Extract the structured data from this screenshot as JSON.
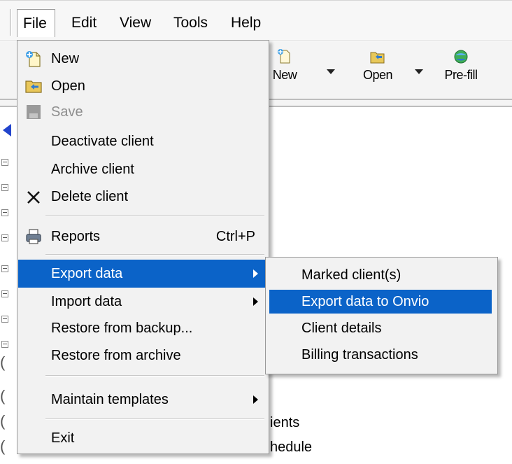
{
  "menubar": {
    "items": [
      "File",
      "Edit",
      "View",
      "Tools",
      "Help"
    ]
  },
  "toolbar": {
    "buttons": [
      {
        "label": "New",
        "icon": "new-document-icon",
        "has_dropdown": true
      },
      {
        "label": "Open",
        "icon": "open-folder-icon",
        "has_dropdown": true
      },
      {
        "label": "Pre-fill",
        "icon": "globe-icon",
        "has_dropdown": false
      }
    ]
  },
  "tree": {
    "partial_texts": [
      "ients",
      "hedule"
    ]
  },
  "file_menu": {
    "items": [
      {
        "label": "New",
        "icon": "new-document-icon",
        "enabled": true
      },
      {
        "label": "Open",
        "icon": "open-folder-icon",
        "enabled": true
      },
      {
        "label": "Save",
        "icon": "save-icon",
        "enabled": false
      },
      {
        "label": "Deactivate client",
        "enabled": true
      },
      {
        "label": "Archive client",
        "enabled": true
      },
      {
        "label": "Delete client",
        "icon": "delete-x-icon",
        "enabled": true
      },
      {
        "label": "Reports",
        "icon": "printer-icon",
        "shortcut": "Ctrl+P",
        "enabled": true
      },
      {
        "label": "Export data",
        "has_submenu": true,
        "highlighted": true
      },
      {
        "label": "Import data",
        "has_submenu": true
      },
      {
        "label": "Restore from backup..."
      },
      {
        "label": "Restore from archive"
      },
      {
        "label": "Maintain templates",
        "has_submenu": true
      },
      {
        "label": "Exit"
      }
    ]
  },
  "export_submenu": {
    "items": [
      {
        "label": "Marked client(s)"
      },
      {
        "label": "Export data to Onvio",
        "highlighted": true
      },
      {
        "label": "Client details"
      },
      {
        "label": "Billing transactions"
      }
    ]
  },
  "colors": {
    "highlight": "#0b63c8",
    "menu_background": "#f2f2f2",
    "disabled_text": "#8e8e8e"
  }
}
